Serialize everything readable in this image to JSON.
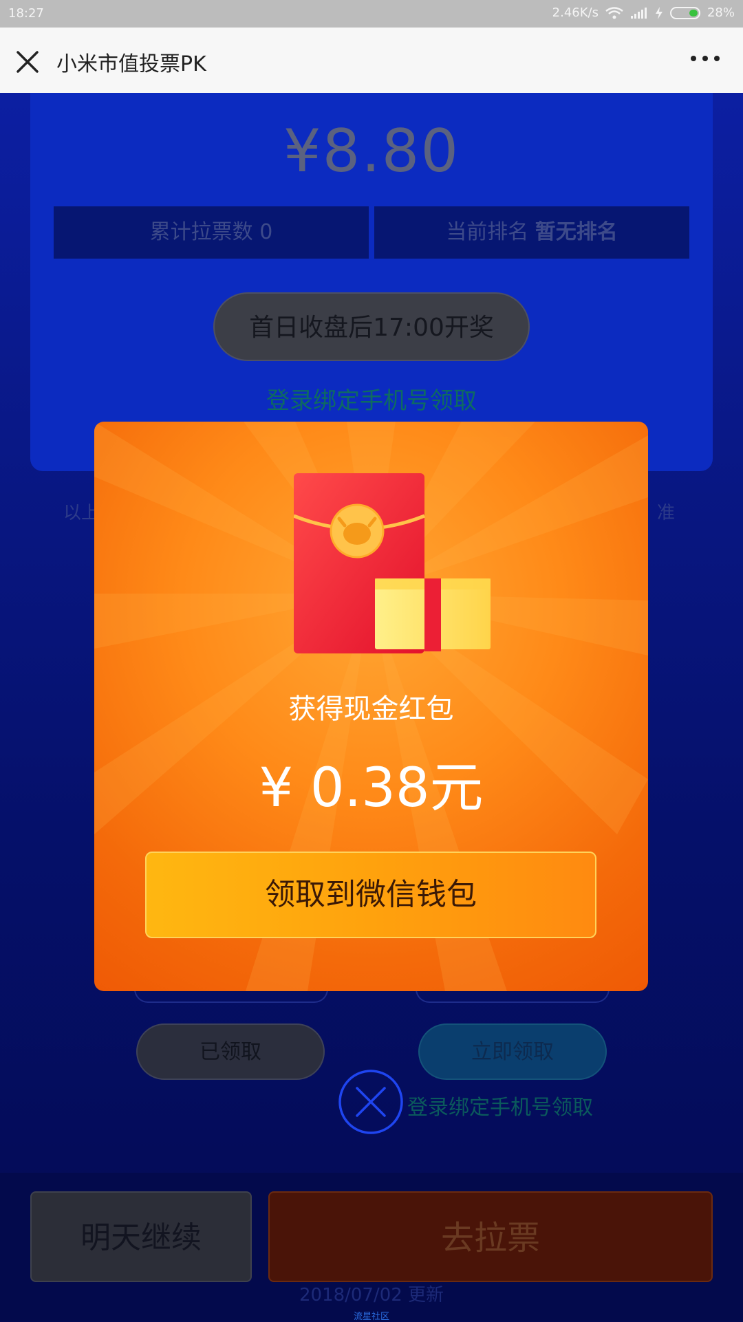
{
  "status_bar": {
    "time": "18:27",
    "speed": "2.46K/s",
    "battery": "28%"
  },
  "title_bar": {
    "title": "小米市值投票PK"
  },
  "background_page": {
    "amount": "¥8.80",
    "stats": {
      "votes_label": "累计拉票数",
      "votes_value": "0",
      "rank_label": "当前排名",
      "rank_value": "暂无排名"
    },
    "prize_time": "首日收盘后17:00开奖",
    "bind_phone_link": "登录绑定手机号领取",
    "side_left": "以上",
    "side_right": "准",
    "received_button": "已领取",
    "claim_now_button": "立即领取",
    "bind_phone_link_2": "登录绑定手机号领取",
    "continue_tomorrow": "明天继续",
    "go_vote": "去拉票",
    "updated": "2018/07/02 更新",
    "footer": "流星社区"
  },
  "modal": {
    "title": "获得现金红包",
    "amount": "¥ 0.38元",
    "claim_button": "领取到微信钱包"
  },
  "colors": {
    "modal_orange": "#f46a0a",
    "claim_button": "#ffa20d",
    "page_blue": "#0c1fa2"
  }
}
